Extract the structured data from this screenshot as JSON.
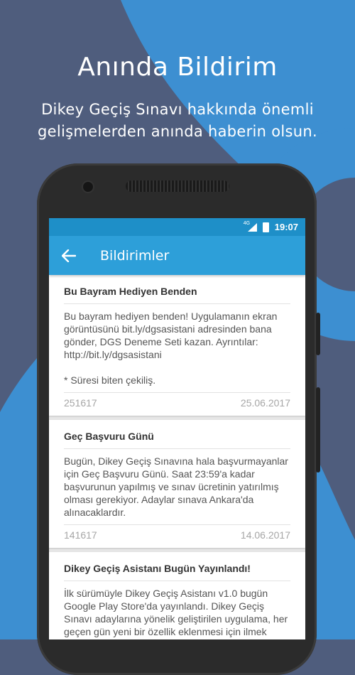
{
  "promo": {
    "headline": "Anında Bildirim",
    "subline": "Dikey Geçiş Sınavı hakkında önemli gelişmelerden anında haberin olsun."
  },
  "status_bar": {
    "network": "4G",
    "time": "19:07"
  },
  "app_bar": {
    "back_icon": "arrow-back-icon",
    "title": "Bildirimler"
  },
  "notifications": [
    {
      "title": "Bu Bayram Hediyen Benden",
      "body": "Bu bayram hediyen benden! Uygulamanın ekran görüntüsünü bit.ly/dgsasistani adresinden bana gönder, DGS Deneme Seti kazan. Ayrıntılar: http://bit.ly/dgsasistani\n\n* Süresi biten çekiliş.",
      "id": "251617",
      "date": "25.06.2017"
    },
    {
      "title": "Geç Başvuru Günü",
      "body": "Bugün, Dikey Geçiş Sınavına hala başvurmayanlar için Geç Başvuru Günü. Saat 23:59'a kadar başvurunun yapılmış ve sınav ücretinin yatırılmış olması gerekiyor. Adaylar sınava Ankara'da alınacaklardır.",
      "id": "141617",
      "date": "14.06.2017"
    },
    {
      "title": "Dikey Geçiş Asistanı Bugün Yayınlandı!",
      "body": "İlk sürümüyle Dikey Geçiş Asistanı v1.0 bugün Google Play Store'da yayınlandı. Dikey Geçiş Sınavı adaylarına yönelik geliştirilen uygulama, her geçen gün yeni bir özellik eklenmesi için ilmek ilmek kodlanıyor.",
      "id": "",
      "date": ""
    }
  ],
  "colors": {
    "background": "#4f5d7d",
    "accent_blue": "#2d9fd9",
    "status_bar": "#1e8fc8"
  }
}
